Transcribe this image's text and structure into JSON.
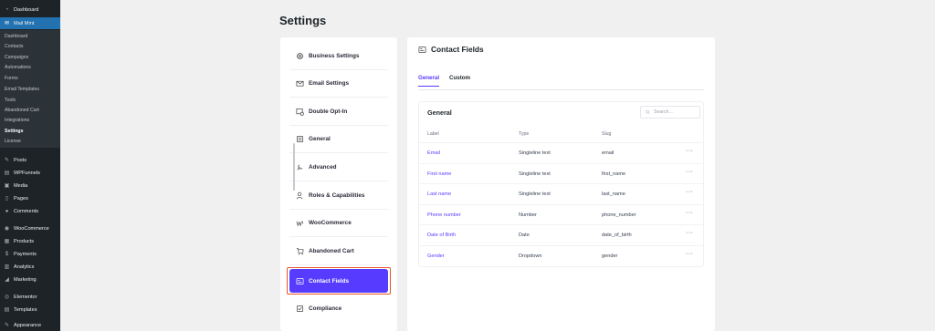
{
  "sidebar": {
    "items": [
      {
        "label": "Dashboard",
        "icon": "dashboard-icon",
        "glyph": "◔"
      },
      {
        "label": "Mail Mint",
        "icon": "mail-icon",
        "glyph": "✉"
      },
      {
        "label": "Posts",
        "icon": "pin-icon",
        "glyph": "✎"
      },
      {
        "label": "WPFunnels",
        "icon": "funnel-icon",
        "glyph": "▤"
      },
      {
        "label": "Media",
        "icon": "media-icon",
        "glyph": "▣"
      },
      {
        "label": "Pages",
        "icon": "pages-icon",
        "glyph": "▯"
      },
      {
        "label": "Comments",
        "icon": "comment-icon",
        "glyph": "●"
      },
      {
        "label": "WooCommerce",
        "icon": "woo-icon",
        "glyph": "◉"
      },
      {
        "label": "Products",
        "icon": "products-icon",
        "glyph": "▦"
      },
      {
        "label": "Payments",
        "icon": "payments-icon",
        "glyph": "$"
      },
      {
        "label": "Analytics",
        "icon": "analytics-icon",
        "glyph": "▥"
      },
      {
        "label": "Marketing",
        "icon": "marketing-icon",
        "glyph": "◢"
      },
      {
        "label": "Elementor",
        "icon": "elementor-icon",
        "glyph": "◎"
      },
      {
        "label": "Templates",
        "icon": "templates-icon",
        "glyph": "▤"
      },
      {
        "label": "Appearance",
        "icon": "appearance-icon",
        "glyph": "✎"
      }
    ],
    "submenu": [
      "Dashboard",
      "Contacts",
      "Campaigns",
      "Automations",
      "Forms",
      "Email Templates",
      "Tools",
      "Abandoned Cart",
      "Integrations",
      "Settings",
      "License"
    ]
  },
  "page": {
    "title": "Settings"
  },
  "settings_nav": [
    {
      "label": "Business Settings",
      "icon": "gear-icon"
    },
    {
      "label": "Email Settings",
      "icon": "envelope-icon"
    },
    {
      "label": "Double Opt-In",
      "icon": "optin-icon"
    },
    {
      "label": "General",
      "icon": "general-icon"
    },
    {
      "label": "Advanced",
      "icon": "advanced-icon"
    },
    {
      "label": "Roles & Capabilities",
      "icon": "roles-icon"
    },
    {
      "label": "WooCommerce",
      "icon": "woocommerce-icon"
    },
    {
      "label": "Abandoned Cart",
      "icon": "cart-icon"
    },
    {
      "label": "Contact Fields",
      "icon": "contact-fields-icon"
    },
    {
      "label": "Compliance",
      "icon": "compliance-icon"
    }
  ],
  "panel": {
    "title": "Contact Fields",
    "tabs": [
      "General",
      "Custom"
    ],
    "card_title": "General",
    "search_placeholder": "Search...",
    "columns": [
      "Label",
      "Type",
      "Slug"
    ],
    "rows": [
      {
        "label": "Email",
        "type": "Singleline text",
        "slug": "email"
      },
      {
        "label": "First name",
        "type": "Singleline text",
        "slug": "first_name"
      },
      {
        "label": "Last name",
        "type": "Singleline text",
        "slug": "last_name"
      },
      {
        "label": "Phone number",
        "type": "Number",
        "slug": "phone_number"
      },
      {
        "label": "Date of Birth",
        "type": "Date",
        "slug": "date_of_birth"
      },
      {
        "label": "Gender",
        "type": "Dropdown",
        "slug": "gender"
      }
    ],
    "more_glyph": "···"
  },
  "colors": {
    "accent": "#573bff",
    "wp_sidebar": "#1d2327",
    "wp_active": "#2271b1",
    "highlight_border": "#e5542a"
  }
}
